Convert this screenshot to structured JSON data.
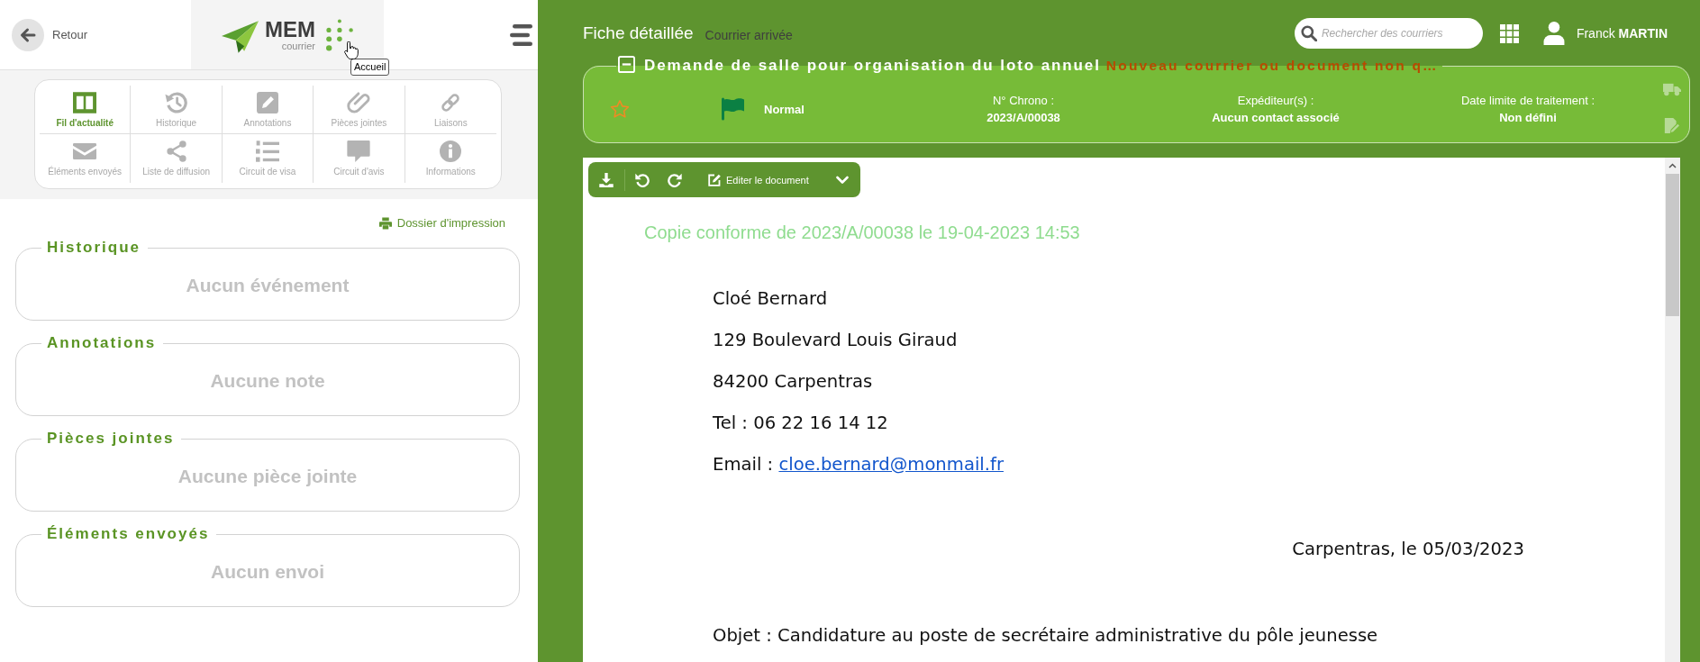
{
  "header": {
    "back_label": "Retour",
    "logo_name": "MEM",
    "logo_subtitle": "courrier",
    "tooltip": "Accueil"
  },
  "nav_grid": [
    {
      "kind": "feed",
      "label": "Fil d'actualité",
      "selected": true
    },
    {
      "kind": "history",
      "label": "Historique",
      "selected": false
    },
    {
      "kind": "annotations",
      "label": "Annotations",
      "selected": false
    },
    {
      "kind": "attachments",
      "label": "Pièces jointes",
      "selected": false
    },
    {
      "kind": "links",
      "label": "Liaisons",
      "selected": false
    },
    {
      "kind": "sent",
      "label": "Éléments envoyés",
      "selected": false
    },
    {
      "kind": "diffusion",
      "label": "Liste de diffusion",
      "selected": false
    },
    {
      "kind": "visa",
      "label": "Circuit de visa",
      "selected": false
    },
    {
      "kind": "opinion",
      "label": "Circuit d'avis",
      "selected": false
    },
    {
      "kind": "info",
      "label": "Informations",
      "selected": false
    }
  ],
  "print_link": "Dossier d'impression",
  "sections": [
    {
      "title": "Historique",
      "empty_text": "Aucun événement"
    },
    {
      "title": "Annotations",
      "empty_text": "Aucune note"
    },
    {
      "title": "Pièces jointes",
      "empty_text": "Aucune pièce jointe"
    },
    {
      "title": "Éléments envoyés",
      "empty_text": "Aucun envoi"
    }
  ],
  "topbar": {
    "title": "Fiche détaillée",
    "subtitle": "Courrier arrivée",
    "search": {
      "placeholder": "Rechercher des courriers"
    },
    "user": {
      "first_name": "Franck",
      "last_name": "MARTIN"
    }
  },
  "mail": {
    "expanded": true,
    "subject": "Demande de salle pour organisation du loto annuel",
    "status": "Nouveau courrier ou document non q…",
    "favorite": false,
    "priority": "Normal",
    "fields": [
      {
        "label": "N° Chrono :",
        "value": "2023/A/00038"
      },
      {
        "label": "Expéditeur(s) :",
        "value": "Aucun contact associé"
      },
      {
        "label": "Date limite de traitement :",
        "value": "Non défini"
      }
    ]
  },
  "viewer": {
    "edit_label": "Editer le document",
    "stamp": "Copie conforme de 2023/A/00038 le 19-04-2023 14:53",
    "address_lines": [
      "Cloé Bernard",
      "129 Boulevard Louis Giraud",
      "84200 Carpentras",
      "Tel : 06 22 16 14 12"
    ],
    "email": {
      "label": "Email :",
      "address": "cloe.bernard@monmail.fr"
    },
    "place_date": "Carpentras, le 05/03/2023",
    "object": "Objet : Candidature au poste de secrétaire administrative du pôle jeunesse"
  }
}
